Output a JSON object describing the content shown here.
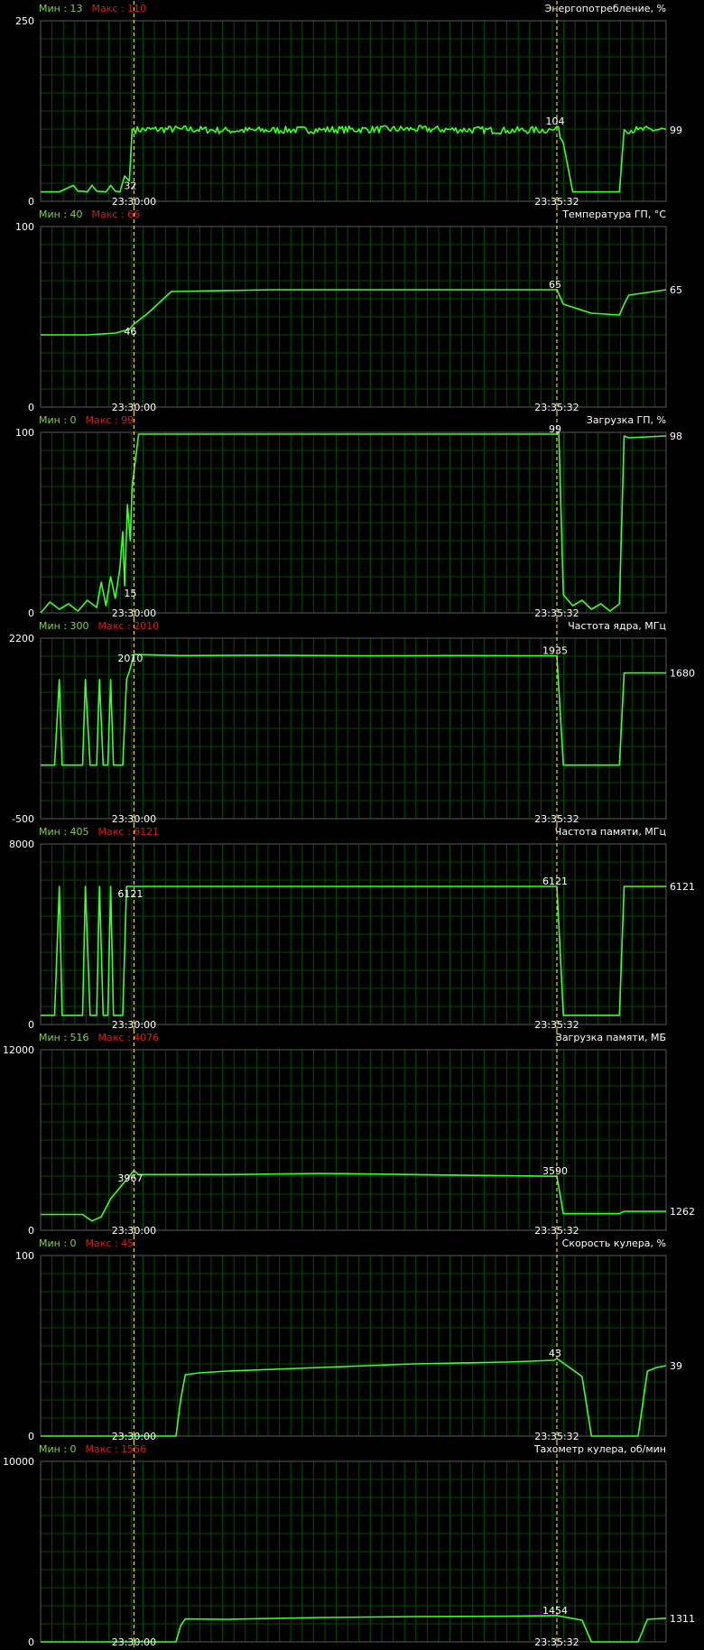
{
  "app": {
    "name": "GPU hardware monitoring graphs"
  },
  "colors": {
    "background": "#000000",
    "grid": "#004d00",
    "frame": "#5a5a5a",
    "line": "#3cff2a",
    "marker_line": "#e8d82a",
    "min_label": "#7fd24a",
    "max_label": "#d81b1b"
  },
  "markers": {
    "left_time": "23:30:00",
    "right_time": "23:35:32"
  },
  "min_prefix": "Мин : ",
  "max_prefix": "Макс : ",
  "chart_data": [
    {
      "type": "line",
      "title": "Энергопотребление, %",
      "min_value": "13",
      "max_value": "110",
      "ylim": [
        0,
        250
      ],
      "y_top_label": "250",
      "y_bottom_label": "0",
      "grid": true,
      "marks": {
        "left": "32",
        "right": "104",
        "last": "99"
      },
      "series": [
        {
          "x": [
            0,
            0.2,
            0.35,
            0.4,
            0.45,
            0.5,
            0.55,
            0.6,
            0.7,
            0.75,
            0.8,
            0.85,
            0.9,
            0.95,
            0.98,
            1.0,
            1.5,
            2,
            3,
            4,
            5,
            5.5,
            5.53,
            5.6,
            5.7,
            6.0,
            6.2,
            6.25,
            6.4,
            6.7
          ],
          "y": [
            13,
            13,
            22,
            14,
            14,
            13,
            22,
            14,
            13,
            22,
            14,
            13,
            35,
            28,
            100,
            99,
            100,
            98,
            99,
            100,
            98,
            99,
            104,
            80,
            13,
            13,
            13,
            99,
            99,
            99
          ]
        }
      ],
      "noise": 5
    },
    {
      "type": "line",
      "title": "Температура ГП, °С",
      "min_value": "40",
      "max_value": "66",
      "ylim": [
        0,
        100
      ],
      "y_top_label": "100",
      "y_bottom_label": "0",
      "grid": true,
      "marks": {
        "left": "46",
        "right": "65",
        "last": "65"
      },
      "series": [
        {
          "x": [
            0,
            0.5,
            0.8,
            0.95,
            1.0,
            1.15,
            1.4,
            2.5,
            4,
            5.5,
            5.53,
            5.6,
            5.9,
            6.2,
            6.25,
            6.3,
            6.7
          ],
          "y": [
            40,
            40,
            41,
            43,
            46,
            52,
            64,
            65,
            65,
            65,
            65,
            57,
            52,
            51,
            57,
            62,
            65
          ]
        }
      ],
      "noise": 0
    },
    {
      "type": "line",
      "title": "Загрузка ГП, %",
      "min_value": "0",
      "max_value": "99",
      "ylim": [
        0,
        100
      ],
      "y_top_label": "100",
      "y_bottom_label": "0",
      "grid": true,
      "marks": {
        "left": "15",
        "right": "99",
        "last": "98"
      },
      "series": [
        {
          "x": [
            0,
            0.1,
            0.2,
            0.3,
            0.4,
            0.5,
            0.6,
            0.65,
            0.7,
            0.75,
            0.8,
            0.85,
            0.88,
            0.9,
            0.93,
            0.96,
            0.98,
            1.05,
            2,
            3,
            4,
            5,
            5.5,
            5.53,
            5.55,
            5.6,
            5.7,
            5.8,
            5.9,
            6.0,
            6.1,
            6.2,
            6.25,
            6.3,
            6.7
          ],
          "y": [
            0,
            6,
            2,
            5,
            1,
            7,
            3,
            17,
            4,
            20,
            8,
            25,
            45,
            15,
            60,
            40,
            70,
            99,
            99,
            99,
            99,
            99,
            99,
            99,
            100,
            10,
            4,
            7,
            2,
            5,
            1,
            5,
            98,
            97,
            98
          ]
        }
      ],
      "noise": 0
    },
    {
      "type": "line",
      "title": "Частота ядра, МГц",
      "min_value": "300",
      "max_value": "2010",
      "ylim": [
        -500,
        2200
      ],
      "y_top_label": "2200",
      "y_bottom_label": "-500",
      "grid": true,
      "marks": {
        "left": "2010",
        "right": "1935",
        "last": "1680"
      },
      "series": [
        {
          "x": [
            0,
            0.15,
            0.2,
            0.23,
            0.3,
            0.45,
            0.48,
            0.53,
            0.6,
            0.63,
            0.67,
            0.72,
            0.75,
            0.78,
            0.85,
            0.88,
            0.92,
            0.95,
            1.0,
            1.5,
            2.5,
            3.5,
            4.5,
            5.5,
            5.53,
            5.6,
            6.0,
            6.2,
            6.25,
            6.7
          ],
          "y": [
            300,
            300,
            1580,
            300,
            300,
            300,
            1580,
            300,
            300,
            1580,
            300,
            300,
            1580,
            300,
            300,
            300,
            1580,
            1700,
            1955,
            1940,
            1945,
            1935,
            1940,
            1935,
            1935,
            300,
            300,
            300,
            1680,
            1680
          ]
        }
      ],
      "noise": 0
    },
    {
      "type": "line",
      "title": "Частота памяти, МГц",
      "min_value": "405",
      "max_value": "6121",
      "ylim": [
        0,
        8000
      ],
      "y_top_label": "8000",
      "y_bottom_label": "0",
      "grid": true,
      "marks": {
        "left": "6121",
        "right": "6121",
        "last": "6121"
      },
      "series": [
        {
          "x": [
            0,
            0.15,
            0.2,
            0.23,
            0.3,
            0.45,
            0.48,
            0.53,
            0.6,
            0.63,
            0.67,
            0.72,
            0.75,
            0.78,
            0.85,
            0.88,
            0.92,
            0.95,
            1.0,
            2,
            3,
            4,
            5,
            5.5,
            5.53,
            5.6,
            6.0,
            6.2,
            6.25,
            6.7
          ],
          "y": [
            405,
            405,
            6121,
            405,
            405,
            405,
            6121,
            405,
            405,
            6121,
            405,
            405,
            6121,
            405,
            405,
            405,
            6121,
            6121,
            6121,
            6121,
            6121,
            6121,
            6121,
            6121,
            6121,
            405,
            405,
            405,
            6121,
            6121
          ]
        }
      ],
      "noise": 0
    },
    {
      "type": "line",
      "title": "Загрузка памяти, МБ",
      "min_value": "516",
      "max_value": "4076",
      "ylim": [
        0,
        12000
      ],
      "y_top_label": "12000",
      "y_bottom_label": "0",
      "grid": true,
      "marks": {
        "left": "3967",
        "right": "3590",
        "last": "1262"
      },
      "series": [
        {
          "x": [
            0,
            0.45,
            0.55,
            0.65,
            0.75,
            1.0,
            1.05,
            2,
            3,
            4,
            5.5,
            5.53,
            5.6,
            6.2,
            6.25,
            6.7
          ],
          "y": [
            1050,
            1050,
            620,
            900,
            2100,
            3967,
            3700,
            3700,
            3780,
            3700,
            3590,
            3590,
            1100,
            1100,
            1262,
            1262
          ]
        }
      ],
      "noise": 0
    },
    {
      "type": "line",
      "title": "Скорость кулера, %",
      "min_value": "0",
      "max_value": "45",
      "ylim": [
        0,
        100
      ],
      "y_top_label": "100",
      "y_bottom_label": "0",
      "grid": true,
      "marks": {
        "left": "",
        "right": "43",
        "last": "39"
      },
      "series": [
        {
          "x": [
            0,
            1.3,
            1.45,
            1.5,
            1.55,
            1.7,
            2.0,
            3.0,
            4.0,
            5.0,
            5.5,
            5.53,
            5.8,
            5.9,
            6.4,
            6.5,
            6.6,
            6.7
          ],
          "y": [
            0,
            0,
            0,
            20,
            34,
            35,
            36,
            38,
            40,
            41,
            42,
            43,
            33,
            0,
            0,
            36,
            38,
            39
          ]
        }
      ],
      "noise": 0
    },
    {
      "type": "line",
      "title": "Тахометр кулера, об/мин",
      "min_value": "0",
      "max_value": "1556",
      "ylim": [
        0,
        10000
      ],
      "y_top_label": "10000",
      "y_bottom_label": "0",
      "grid": true,
      "marks": {
        "left": "",
        "right": "1454",
        "last": "1311"
      },
      "series": [
        {
          "x": [
            0,
            1.3,
            1.45,
            1.5,
            1.55,
            2,
            3,
            4,
            5,
            5.5,
            5.53,
            5.8,
            5.9,
            6.4,
            6.5,
            6.7
          ],
          "y": [
            0,
            0,
            0,
            900,
            1270,
            1250,
            1350,
            1400,
            1420,
            1454,
            1454,
            1200,
            0,
            0,
            1250,
            1311
          ]
        }
      ],
      "noise": 0
    }
  ]
}
